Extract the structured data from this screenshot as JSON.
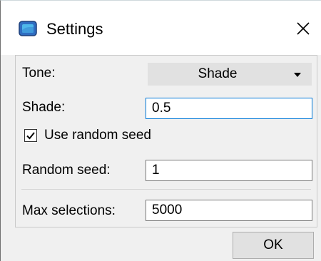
{
  "window": {
    "title": "Settings",
    "icon": "app-window-icon",
    "close_icon": "close-icon"
  },
  "form": {
    "tone": {
      "label": "Tone:",
      "value": "Shade",
      "options": [
        "Shade"
      ]
    },
    "shade": {
      "label": "Shade:",
      "value": "0.5"
    },
    "use_random_seed": {
      "label": "Use random seed",
      "checked": true
    },
    "random_seed": {
      "label": "Random seed:",
      "value": "1"
    },
    "max_selections": {
      "label": "Max selections:",
      "value": "5000"
    }
  },
  "buttons": {
    "ok_label": "OK"
  },
  "colors": {
    "accent": "#0078d7",
    "icon_fill": "#2f6dc1",
    "icon_inner": "#4fb8ea"
  }
}
